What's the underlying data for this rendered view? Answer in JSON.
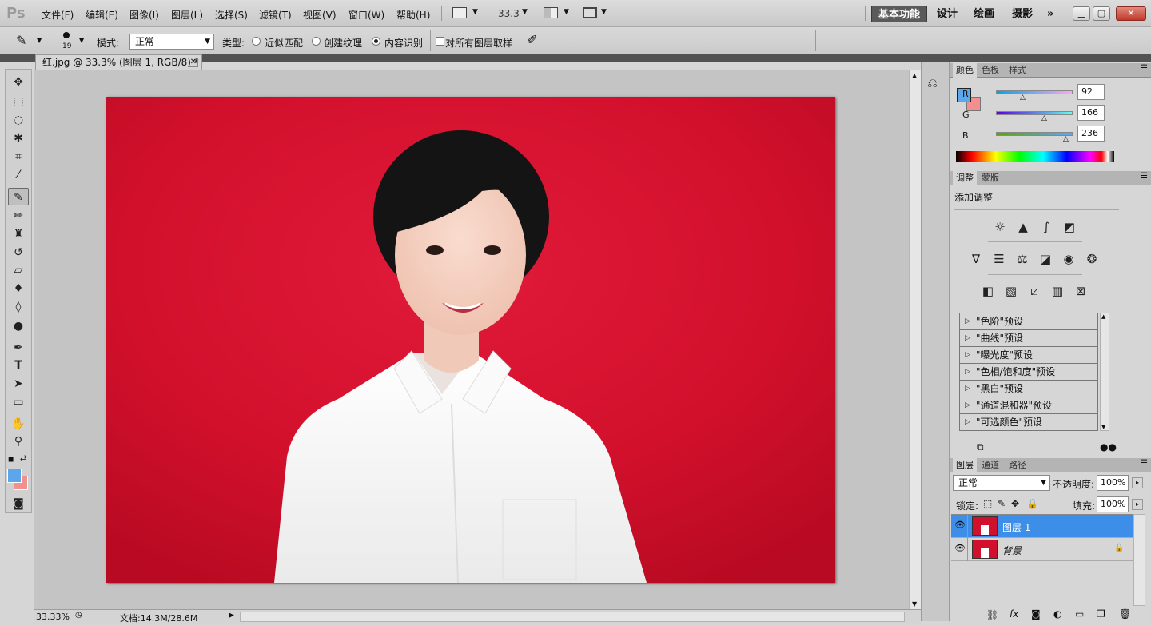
{
  "menubar": {
    "logo": "Ps",
    "menus": [
      "文件(F)",
      "编辑(E)",
      "图像(I)",
      "图层(L)",
      "选择(S)",
      "滤镜(T)",
      "视图(V)",
      "窗口(W)",
      "帮助(H)"
    ],
    "zoom_value": "33.3",
    "workspaces": [
      "基本功能",
      "设计",
      "绘画",
      "摄影"
    ],
    "more_label": "»"
  },
  "options": {
    "brush_size": "19",
    "mode_label": "模式:",
    "mode_value": "正常",
    "type_label": "类型:",
    "radio_options": [
      "近似匹配",
      "创建纹理",
      "内容识别"
    ],
    "selected_radio": "内容识别",
    "sample_all_label": "对所有图层取样"
  },
  "document": {
    "tab_title": "红.jpg @ 33.3% (图层 1, RGB/8) *",
    "zoom_status": "33.33%",
    "doc_info": "文档:14.3M/28.6M"
  },
  "colors": {
    "foreground": "#5ca6ec",
    "background": "#f28f8f",
    "photo_bg": "#d4102e",
    "accent_selected": "#3d8ee8"
  },
  "color_panel": {
    "tabs": [
      "颜色",
      "色板",
      "样式"
    ],
    "channels": [
      {
        "label": "R",
        "value": "92"
      },
      {
        "label": "G",
        "value": "166"
      },
      {
        "label": "B",
        "value": "236"
      }
    ]
  },
  "adjustments_panel": {
    "tabs": [
      "调整",
      "蒙版"
    ],
    "title": "添加调整",
    "icons_row1": [
      "brightness-icon",
      "levels-icon",
      "curves-icon",
      "exposure-icon"
    ],
    "icons_row2": [
      "vibrance-icon",
      "hue-saturation-icon",
      "color-balance-icon",
      "black-white-icon",
      "photo-filter-icon",
      "channel-mixer-icon"
    ],
    "icons_row3": [
      "invert-icon",
      "posterize-icon",
      "threshold-icon",
      "gradient-map-icon",
      "selective-color-icon"
    ],
    "presets": [
      "\"色阶\"预设",
      "\"曲线\"预设",
      "\"曝光度\"预设",
      "\"色相/饱和度\"预设",
      "\"黑白\"预设",
      "\"通道混和器\"预设",
      "\"可选颜色\"预设"
    ]
  },
  "layers_panel": {
    "tabs": [
      "图层",
      "通道",
      "路径"
    ],
    "blend_mode": "正常",
    "opacity_label": "不透明度:",
    "opacity_value": "100%",
    "lock_label": "锁定:",
    "fill_label": "填充:",
    "fill_value": "100%",
    "layers": [
      {
        "name": "图层 1",
        "selected": true
      },
      {
        "name": "背景",
        "selected": false
      }
    ]
  }
}
